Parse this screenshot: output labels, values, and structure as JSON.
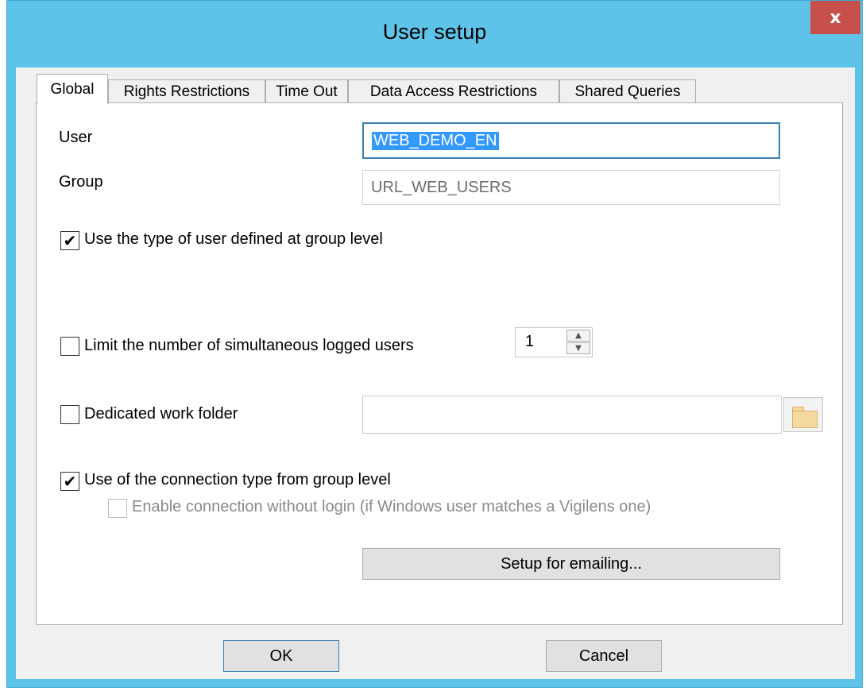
{
  "window": {
    "title": "User setup",
    "close_glyph": "x"
  },
  "tabs": [
    {
      "label": "Global",
      "active": true
    },
    {
      "label": "Rights Restrictions",
      "active": false
    },
    {
      "label": "Time Out",
      "active": false
    },
    {
      "label": "Data Access Restrictions",
      "active": false
    },
    {
      "label": "Shared Queries",
      "active": false
    }
  ],
  "form": {
    "user_label": "User",
    "user_value": "WEB_DEMO_EN",
    "group_label": "Group",
    "group_value": "URL_WEB_USERS",
    "use_group_type": {
      "label": "Use the type of user defined at group level",
      "checked": true
    },
    "limit_sessions": {
      "label": "Limit the number of simultaneous logged users",
      "checked": false,
      "value": "1"
    },
    "work_folder": {
      "label": "Dedicated work folder",
      "checked": false,
      "value": ""
    },
    "use_connection_type": {
      "label": "Use of the connection type from group level",
      "checked": true
    },
    "connection_without_login": {
      "label": "Enable connection without login (if Windows user matches a Vigilens one)",
      "checked": false,
      "enabled": false
    },
    "email_setup_button": "Setup for emailing..."
  },
  "footer": {
    "ok_label": "OK",
    "cancel_label": "Cancel"
  },
  "icons": {
    "checkmark": "✔",
    "spin_up": "▲",
    "spin_down": "▼",
    "folder": "folder-icon"
  },
  "colors": {
    "titlebar": "#5ec3e8",
    "close_button": "#c7504b",
    "selection": "#3399ff",
    "focus_border": "#3c7fb1"
  }
}
